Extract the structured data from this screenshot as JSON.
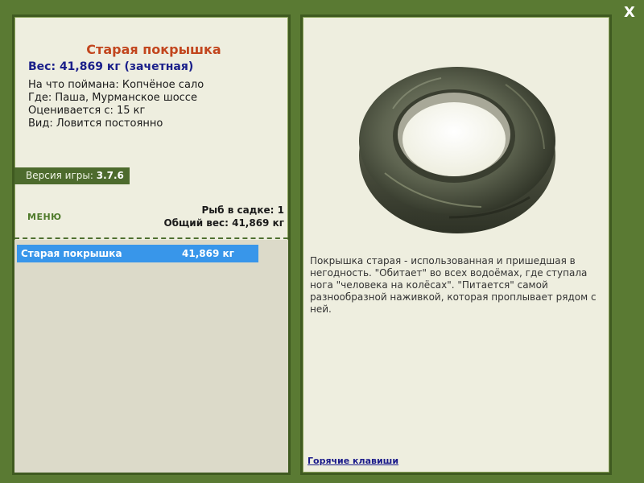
{
  "window": {
    "close_label": "X"
  },
  "fish": {
    "title": "Старая покрышка",
    "weight_line": "Вес: 41,869 кг (зачетная)",
    "caught_on": "На что поймана: Копчёное сало",
    "location": "Где: Паша, Мурманское шоссе",
    "valued_from": "Оценивается с: 15 кг",
    "kind": "Вид: Ловится постоянно",
    "image_icon": "tire-image",
    "description": "Покрышка старая - использованная и пришедшая в негодность. \"Обитает\" во всех водоёмах, где ступала нога \"человека на колёсах\". \"Питается\" самой разнообразной наживкой, которая проплывает рядом с ней."
  },
  "version": {
    "label": "Версия игры:",
    "value": "3.7.6"
  },
  "menu": {
    "label": "МЕНЮ"
  },
  "stats": {
    "fish_count": "Рыб в садке: 1",
    "total_weight": "Общий вес: 41,869 кг"
  },
  "catch_list": [
    {
      "name": "Старая покрышка",
      "weight": "41,869 кг"
    }
  ],
  "links": {
    "hotkeys": "Горячие клавиши"
  },
  "colors": {
    "background": "#5a7a33",
    "panel": "#eeeedf",
    "title": "#c2461e",
    "weight": "#1a1f8a",
    "selection": "#3896ea"
  }
}
